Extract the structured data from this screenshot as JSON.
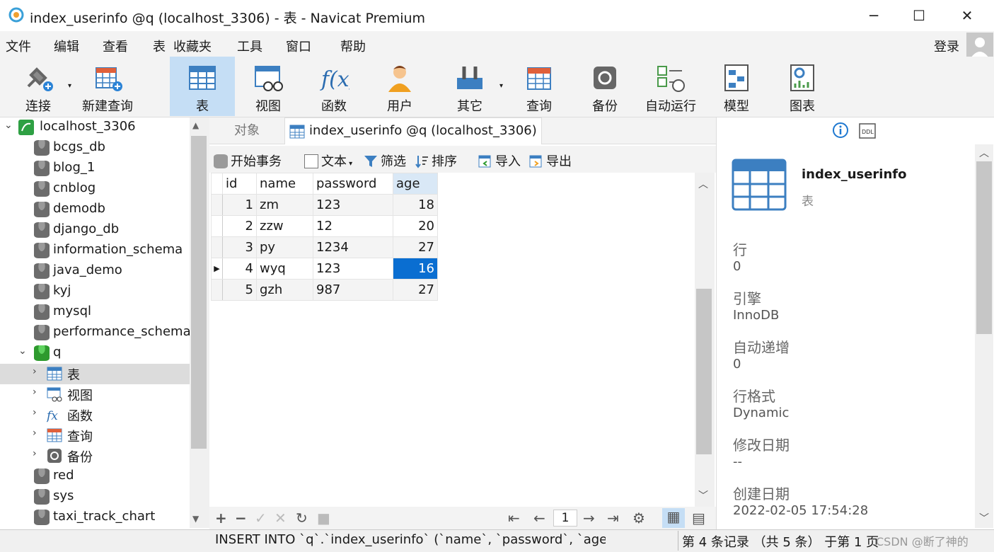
{
  "window": {
    "title": "index_userinfo @q (localhost_3306) - 表 - Navicat Premium",
    "minimize": "─",
    "maximize": "☐",
    "close": "✕"
  },
  "menu": {
    "items": [
      "文件",
      "编辑",
      "查看",
      "表",
      "收藏夹",
      "工具",
      "窗口",
      "帮助"
    ],
    "login": "登录"
  },
  "toolbar": {
    "buttons": [
      {
        "label": "连接",
        "icon": "connect-icon"
      },
      {
        "label": "新建查询",
        "icon": "new-query-icon"
      },
      {
        "label": "表",
        "icon": "table-icon",
        "active": true
      },
      {
        "label": "视图",
        "icon": "view-icon"
      },
      {
        "label": "函数",
        "icon": "function-icon"
      },
      {
        "label": "用户",
        "icon": "user-icon"
      },
      {
        "label": "其它",
        "icon": "other-icon"
      },
      {
        "label": "查询",
        "icon": "query-icon"
      },
      {
        "label": "备份",
        "icon": "backup-icon"
      },
      {
        "label": "自动运行",
        "icon": "automation-icon"
      },
      {
        "label": "模型",
        "icon": "model-icon"
      },
      {
        "label": "图表",
        "icon": "chart-icon"
      }
    ]
  },
  "sidebar": {
    "connection": "localhost_3306",
    "databases": [
      "bcgs_db",
      "blog_1",
      "cnblog",
      "demodb",
      "django_db",
      "information_schema",
      "java_demo",
      "kyj",
      "mysql",
      "performance_schema"
    ],
    "open_db": "q",
    "open_db_children": [
      "表",
      "视图",
      "函数",
      "查询",
      "备份"
    ],
    "databases_after": [
      "red",
      "sys",
      "taxi_track_chart"
    ]
  },
  "tabs": {
    "objects": "对象",
    "table": "index_userinfo @q (localhost_3306) ..."
  },
  "subtoolbar": {
    "begin_transaction": "开始事务",
    "text": "文本",
    "filter": "筛选",
    "sort": "排序",
    "import": "导入",
    "export": "导出"
  },
  "grid": {
    "columns": [
      "id",
      "name",
      "password",
      "age"
    ],
    "rows": [
      [
        "1",
        "zm",
        "123",
        "18"
      ],
      [
        "2",
        "zzw",
        "12",
        "20"
      ],
      [
        "3",
        "py",
        "1234",
        "27"
      ],
      [
        "4",
        "wyq",
        "123",
        "16"
      ],
      [
        "5",
        "gzh",
        "987",
        "27"
      ]
    ],
    "current_row": 4,
    "page": "1"
  },
  "info": {
    "table_name": "index_userinfo",
    "type": "表",
    "fields": [
      {
        "label": "行",
        "value": "0"
      },
      {
        "label": "引擎",
        "value": "InnoDB"
      },
      {
        "label": "自动递增",
        "value": "0"
      },
      {
        "label": "行格式",
        "value": "Dynamic"
      },
      {
        "label": "修改日期",
        "value": "--"
      },
      {
        "label": "创建日期",
        "value": "2022-02-05 17:54:28"
      }
    ]
  },
  "status": {
    "sql": "INSERT INTO `q`.`index_userinfo` (`name`, `password`, `age`) VALU",
    "records": "第 4 条记录 （共 5 条） 于第 1 页",
    "watermark": "CSDN @断了神的"
  },
  "colors": {
    "accent": "#0a6ed1",
    "active_tab": "#c5def5",
    "table_icon": "#3c7fc1"
  }
}
